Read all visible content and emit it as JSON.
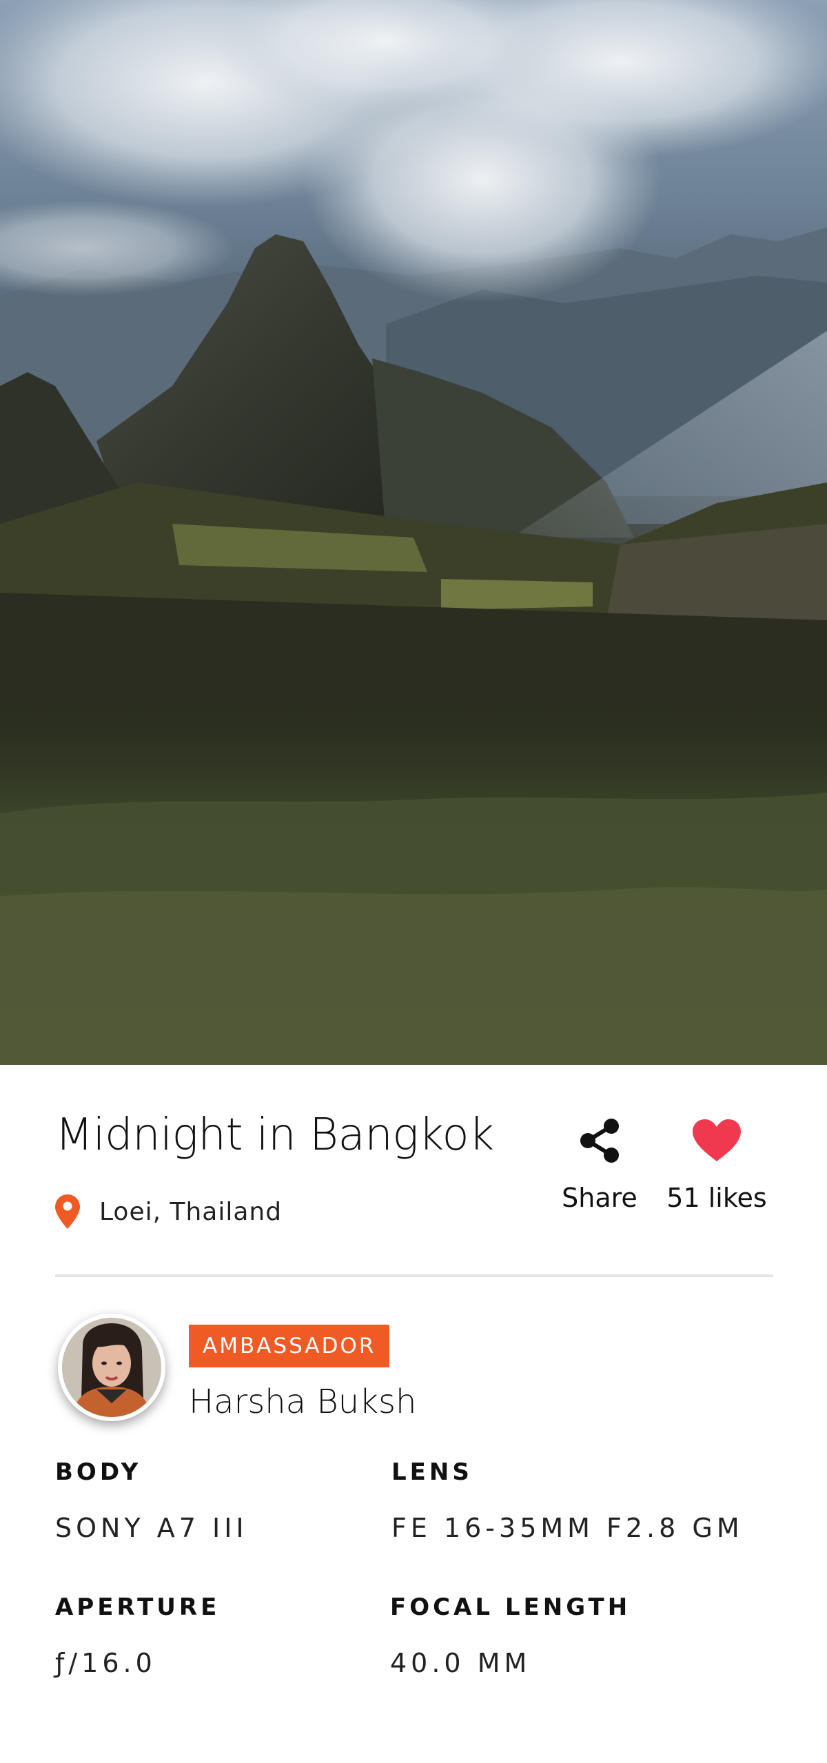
{
  "photo": {
    "title": "Midnight in Bangkok",
    "location": "Loei, Thailand"
  },
  "actions": {
    "share_label": "Share",
    "likes_label": "51 likes"
  },
  "photographer": {
    "badge": "AMBASSADOR",
    "name": "Harsha Buksh"
  },
  "specs": [
    {
      "label": "BODY",
      "value": "SONY A7 III"
    },
    {
      "label": "LENS",
      "value": "FE 16-35MM F2.8 GM"
    },
    {
      "label": "APERTURE",
      "value": "ƒ/16.0"
    },
    {
      "label": "FOCAL LENGTH",
      "value": "40.0 MM"
    }
  ],
  "colors": {
    "accent": "#f05a24",
    "like": "#f0394f",
    "divider": "#e4e4e4"
  },
  "icons": {
    "location": "map-pin-icon",
    "share": "share-icon",
    "like": "heart-icon"
  }
}
